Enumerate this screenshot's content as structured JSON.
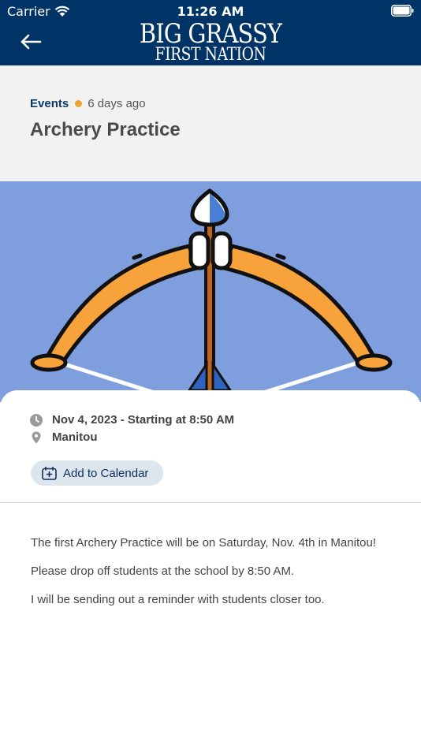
{
  "status_bar": {
    "carrier": "Carrier",
    "time": "11:26 AM"
  },
  "header": {
    "logo_line1": "BIG GRASSY",
    "logo_line2": "FIRST NATION",
    "background": "#003366"
  },
  "post": {
    "category": "Events",
    "age": "6 days ago",
    "title": "Archery Practice"
  },
  "event": {
    "date": "Nov 4, 2023 - Starting at 8:50 AM",
    "location": "Manitou",
    "calendar_button": "Add to Calendar"
  },
  "body": {
    "paragraphs": [
      "The first Archery Practice will be on Saturday, Nov. 4th in Manitou!",
      "Please drop off students at the school by 8:50 AM.",
      "I will be sending out a reminder with students closer too."
    ]
  },
  "colors": {
    "accent": "#e8a530",
    "hero_bg": "#7f9edd",
    "bow": "#f7a23b"
  },
  "icons": [
    "wifi-icon",
    "battery-icon",
    "back-arrow-icon",
    "clock-icon",
    "location-pin-icon",
    "calendar-add-icon"
  ]
}
